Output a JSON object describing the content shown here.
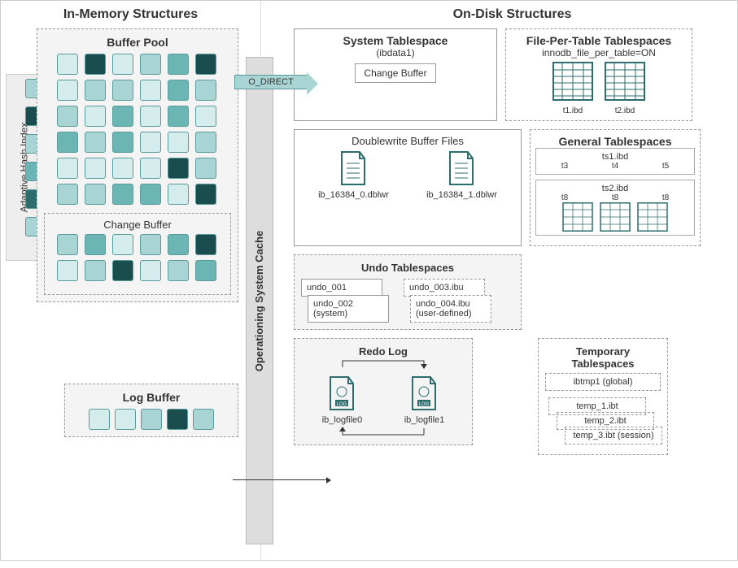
{
  "left": {
    "title": "In-Memory Structures",
    "buffer_pool": {
      "title": "Buffer Pool",
      "change_buffer": "Change Buffer"
    },
    "ahi": "Adaptive Hash Index",
    "log_buffer": "Log Buffer"
  },
  "os_cache": "Operationing System Cache",
  "o_direct": "O_DIRECT",
  "right": {
    "title": "On-Disk Structures",
    "system_tablespace": {
      "title": "System Tablespace",
      "sub": "(ibdata1)",
      "change_buffer": "Change Buffer"
    },
    "file_per_table": {
      "title": "File-Per-Table Tablespaces",
      "setting": "innodb_file_per_table=ON",
      "t1": "t1.ibd",
      "t2": "t2.ibd"
    },
    "doublewrite": {
      "title": "Doublewrite Buffer Files",
      "f1": "ib_16384_0.dblwr",
      "f2": "ib_16384_1.dblwr"
    },
    "general": {
      "title": "General Tablespaces",
      "ts1": "ts1.ibd",
      "ts1_cols": [
        "t3",
        "t4",
        "t5"
      ],
      "ts2": "ts2.ibd",
      "ts2_cols": [
        "t8",
        "t8",
        "t8"
      ]
    },
    "undo": {
      "title": "Undo Tablespaces",
      "u1": "undo_001",
      "u2": "undo_002 (system)",
      "u3": "undo_003.ibu",
      "u4": "undo_004.ibu (user-defined)"
    },
    "temp": {
      "title": "Temporary Tablespaces",
      "global": "ibtmp1 (global)",
      "s1": "temp_1.ibt",
      "s2": "temp_2.ibt",
      "s3": "temp_3.ibt (session)"
    },
    "redo": {
      "title": "Redo Log",
      "f1": "ib_logfile0",
      "f2": "ib_logfile1"
    }
  }
}
